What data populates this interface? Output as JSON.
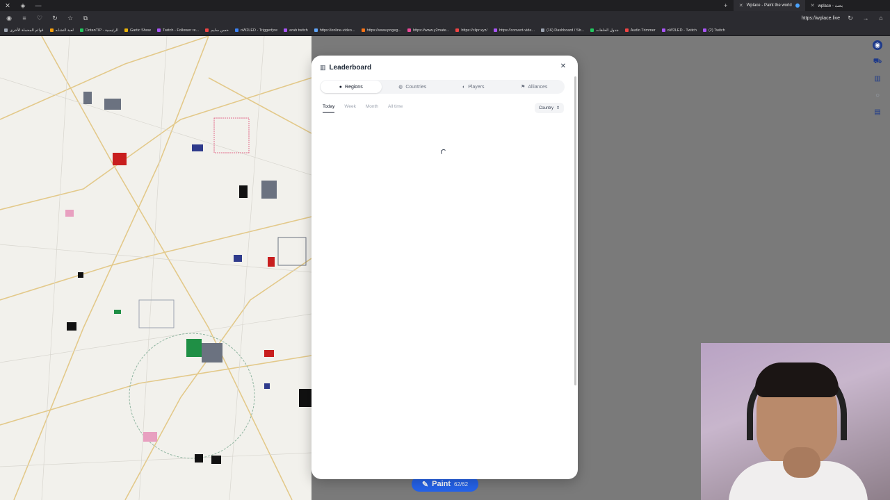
{
  "browser": {
    "tabs": [
      {
        "label": "Wplace - Paint the world",
        "active": true
      },
      {
        "label": "wplace - بحث",
        "active": false
      }
    ],
    "url": "https://wplace.live",
    "bookmarks": [
      {
        "label": "قوائم المحملة الأخرى",
        "color": "#9ca3af"
      },
      {
        "label": "لعبة التشابه",
        "color": "#f59e0b"
      },
      {
        "label": "DotanTIP - الرئيسية",
        "color": "#22c55e"
      },
      {
        "label": "Gartic Show",
        "color": "#eab308"
      },
      {
        "label": "Twitch - Follower re...",
        "color": "#a855f7"
      },
      {
        "label": "حسن سليم",
        "color": "#ef4444"
      },
      {
        "label": "oW2LED - Triggerfyre",
        "color": "#3b82f6"
      },
      {
        "label": "arab twitch",
        "color": "#a855f7"
      },
      {
        "label": "https://online-video...",
        "color": "#60a5fa"
      },
      {
        "label": "https://www.pngeg...",
        "color": "#f97316"
      },
      {
        "label": "https://www.y2mate...",
        "color": "#ec4899"
      },
      {
        "label": "https://clipr.xyz/",
        "color": "#ef4444"
      },
      {
        "label": "https://convert-vide...",
        "color": "#a855f7"
      },
      {
        "label": "(16) Dashboard / Str...",
        "color": "#9ca3af"
      },
      {
        "label": "جدول الحلقات",
        "color": "#22c55e"
      },
      {
        "label": "Audio Trimmer",
        "color": "#ef4444"
      },
      {
        "label": "oW2LED - Twitch",
        "color": "#a855f7"
      },
      {
        "label": "(2) Twitch",
        "color": "#a855f7"
      }
    ]
  },
  "leaderboard": {
    "title": "Leaderboard",
    "tabs": [
      {
        "label": "Regions",
        "icon": "pin-icon",
        "active": true
      },
      {
        "label": "Countries",
        "icon": "globe-icon",
        "active": false
      },
      {
        "label": "Players",
        "icon": "user-icon",
        "active": false
      },
      {
        "label": "Alliances",
        "icon": "flag-icon",
        "active": false
      }
    ],
    "periods": [
      {
        "label": "Today",
        "active": true
      },
      {
        "label": "Week",
        "active": false
      },
      {
        "label": "Month",
        "active": false
      },
      {
        "label": "All time",
        "active": false
      }
    ],
    "filter": {
      "selected": "Country"
    }
  },
  "paint": {
    "label": "Paint",
    "count": "62/62"
  },
  "colors": {
    "accent": "#2563eb"
  }
}
